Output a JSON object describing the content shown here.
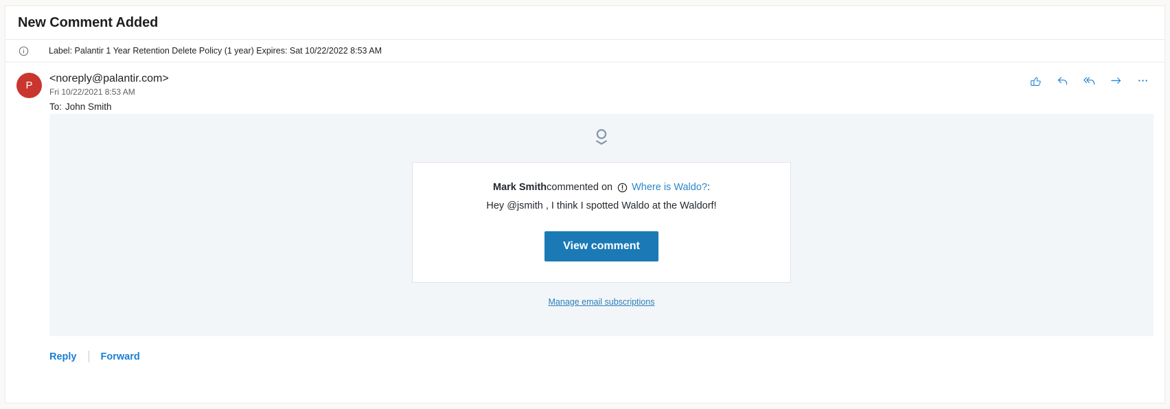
{
  "subject": "New Comment Added",
  "retention": {
    "icon": "info-circle-icon",
    "text": "Label: Palantir 1 Year Retention Delete Policy (1 year) Expires: Sat 10/22/2022 8:53 AM"
  },
  "message": {
    "avatar_initial": "P",
    "avatar_color": "#c8362f",
    "sender": "<noreply@palantir.com>",
    "date": "Fri 10/22/2021 8:53 AM",
    "to_label": "To:",
    "to_recipients": "John Smith",
    "actions": [
      {
        "name": "like-icon",
        "title": "Like"
      },
      {
        "name": "reply-icon",
        "title": "Reply"
      },
      {
        "name": "reply-all-icon",
        "title": "Reply all"
      },
      {
        "name": "forward-arrow-icon",
        "title": "Forward"
      },
      {
        "name": "more-options-icon",
        "title": "More actions"
      }
    ]
  },
  "body": {
    "brand_icon": "person-avatar-icon",
    "card": {
      "commenter": "Mark Smith",
      "commented_on": " commented on ",
      "alert_icon": "exclamation-circle-icon",
      "issue_link": "Where is Waldo?",
      "colon": ":",
      "comment_text": "Hey @jsmith , I think I spotted Waldo at the Waldorf!",
      "cta_label": "View comment",
      "cta_color": "#1b7ab5"
    },
    "manage_link": "Manage email subscriptions"
  },
  "footer": {
    "reply_label": "Reply",
    "forward_label": "Forward"
  }
}
